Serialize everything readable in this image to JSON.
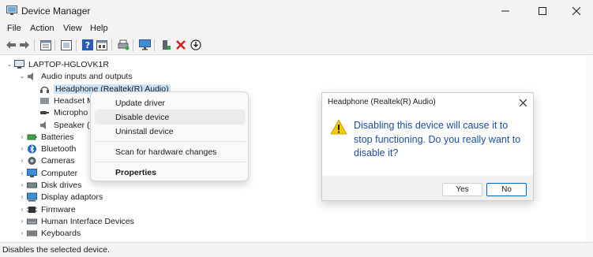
{
  "window": {
    "title": "Device Manager",
    "icon": "device-manager-icon",
    "controls": [
      "minimize-icon",
      "maximize-icon",
      "close-icon"
    ]
  },
  "menubar": {
    "items": [
      "File",
      "Action",
      "View",
      "Help"
    ]
  },
  "toolbar": {
    "buttons": [
      "back-icon",
      "forward-icon",
      "properties-pane-icon",
      "list-view-icon",
      "help-icon",
      "details-icon",
      "print-icon",
      "monitor-icon",
      "add-driver-icon",
      "remove-icon",
      "download-icon"
    ]
  },
  "tree": {
    "root": "LAPTOP-HGLOVK1R",
    "expanded_category": "Audio inputs and outputs",
    "children": [
      "Headphone (Realtek(R) Audio)",
      "Headset M",
      "Micropho",
      "Speaker (R"
    ],
    "categories": [
      "Batteries",
      "Bluetooth",
      "Cameras",
      "Computer",
      "Disk drives",
      "Display adaptors",
      "Firmware",
      "Human Interface Devices",
      "Keyboards"
    ]
  },
  "context_menu": {
    "items": [
      "Update driver",
      "Disable device",
      "Uninstall device",
      "Scan for hardware changes",
      "Properties"
    ],
    "highlighted": "Disable device"
  },
  "dialog": {
    "title": "Headphone (Realtek(R) Audio)",
    "message": "Disabling this device will cause it to stop functioning. Do you really want to disable it?",
    "yes_label": "Yes",
    "no_label": "No",
    "icon": "warning-icon"
  },
  "statusbar": {
    "text": "Disables the selected device."
  },
  "colors": {
    "accent": "#0067c0",
    "message_text": "#1a4f9e",
    "selection": "#cce4f7",
    "warning": "#f2c811"
  }
}
